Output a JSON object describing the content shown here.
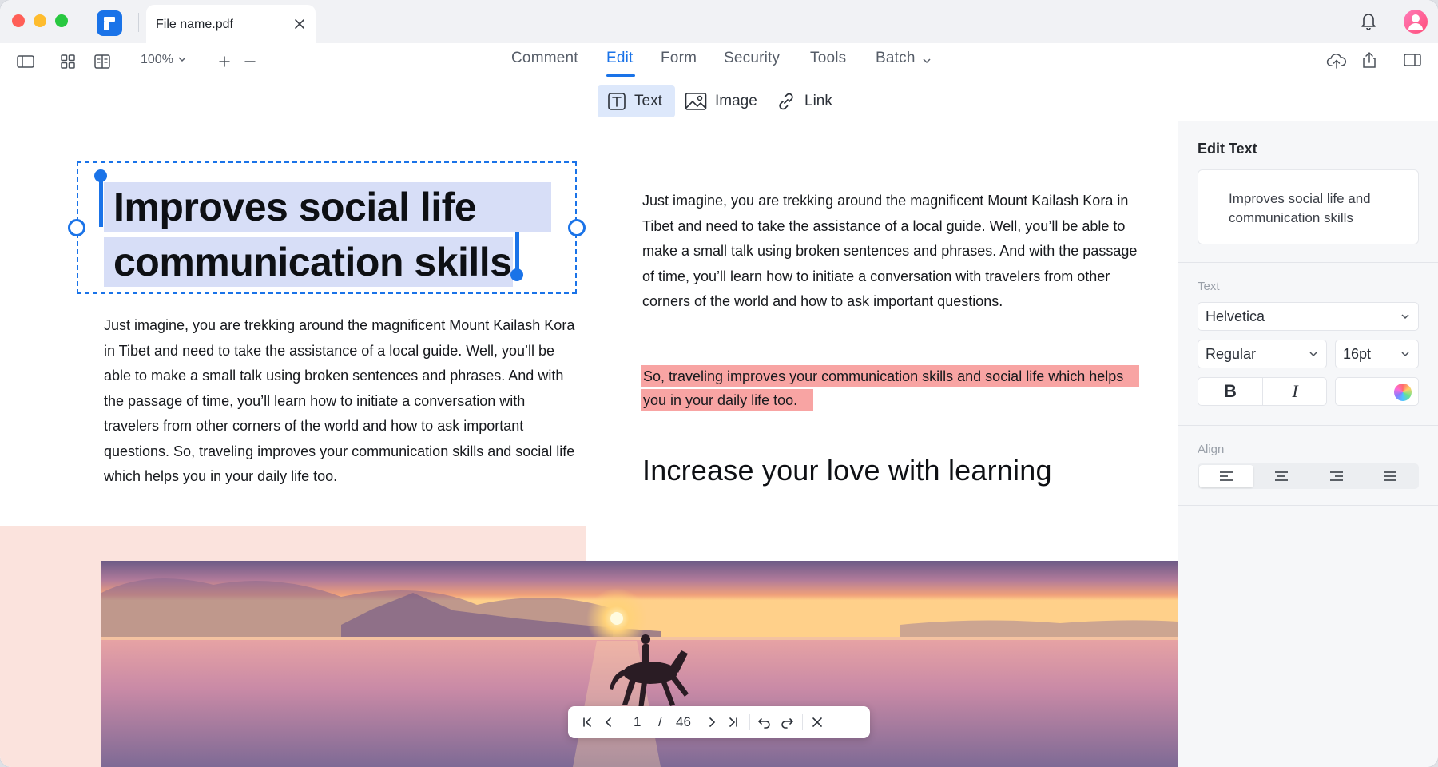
{
  "window": {
    "file_tab_title": "File name.pdf"
  },
  "toolbar": {
    "zoom": "100%",
    "main_tabs": [
      {
        "label": "Comment",
        "active": false
      },
      {
        "label": "Edit",
        "active": true
      },
      {
        "label": "Form",
        "active": false
      },
      {
        "label": "Security",
        "active": false
      },
      {
        "label": "Tools",
        "active": false
      },
      {
        "label": "Batch",
        "active": false
      }
    ],
    "sub_tools": [
      {
        "label": "Text",
        "icon": "text-box-icon",
        "active": true
      },
      {
        "label": "Image",
        "icon": "image-icon",
        "active": false
      },
      {
        "label": "Link",
        "icon": "link-icon",
        "active": false
      }
    ]
  },
  "document": {
    "headline_line1": "Improves social life and",
    "headline_line2": "communication skills",
    "left_paragraph": "Just imagine, you are trekking around the magnificent Mount Kailash Kora in Tibet and need to take the assistance of a local guide. Well, you’ll be able to make a small talk using broken sentences and phrases. And with the passage of time, you’ll learn how to initiate a conversation with travelers from other corners of the world and how to ask important questions. So, traveling improves your communication skills and social life which helps you in your daily life too.",
    "right_paragraph": "Just imagine, you are trekking around the magnificent Mount Kailash Kora in Tibet and need to take the assistance of a local guide. Well, you’ll be able to make a small talk using broken sentences and phrases. And with the passage of time, you’ll learn how to initiate a conversation with travelers from other corners of the world and how to ask important questions.",
    "highlighted_text": "So, traveling improves your communication skills and social life which helps you in your daily life too.",
    "section_heading": "Increase your love with learning",
    "highlight_color": "#f8a4a3",
    "selection_color": "#1a73e8"
  },
  "pager": {
    "current_page": "1",
    "separator": "/",
    "total_pages": "46"
  },
  "panel": {
    "title": "Edit Text",
    "preview_text": "Improves social life and communication skills",
    "text_label": "Text",
    "font_family": "Helvetica",
    "font_weight": "Regular",
    "font_size": "16pt",
    "bold_label": "B",
    "italic_label": "I",
    "align_label": "Align",
    "align_options": [
      "align-left",
      "align-center",
      "align-right",
      "align-justify"
    ],
    "align_selected": "align-left"
  },
  "colors": {
    "accent": "#1a73e8",
    "pink_block": "#fbe3dd"
  }
}
